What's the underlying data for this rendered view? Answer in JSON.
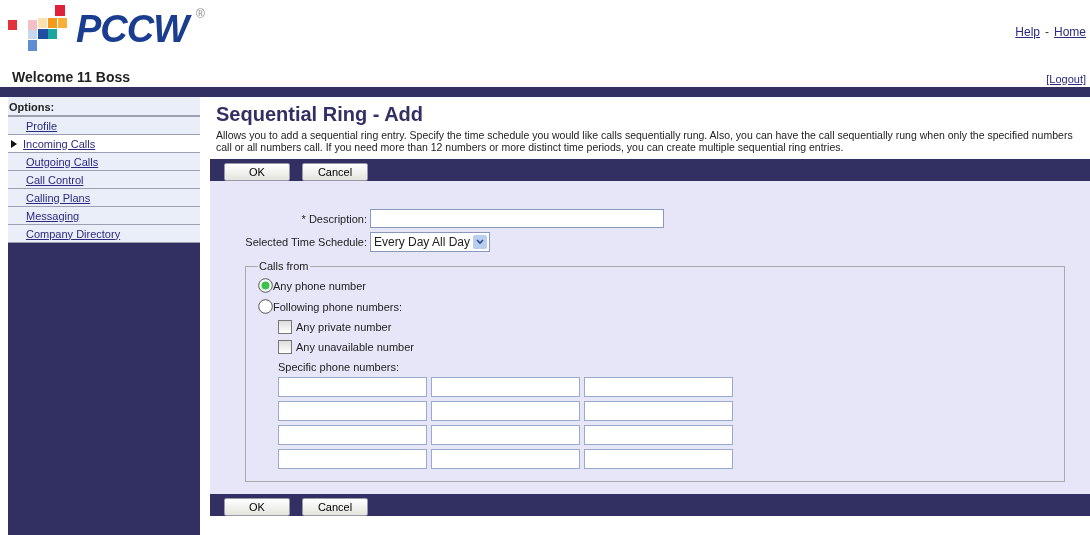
{
  "header": {
    "logo_text": "PCCW",
    "logo_mark": "®",
    "links": [
      {
        "label": "Help"
      },
      {
        "label": "Home"
      }
    ],
    "separator": "-",
    "welcome": "Welcome 11 Boss",
    "logout": "[Logout]"
  },
  "sidebar": {
    "title": "Options:",
    "items": [
      {
        "label": "Profile",
        "selected": false
      },
      {
        "label": "Incoming Calls",
        "selected": true
      },
      {
        "label": "Outgoing Calls",
        "selected": false
      },
      {
        "label": "Call Control",
        "selected": false
      },
      {
        "label": "Calling Plans",
        "selected": false
      },
      {
        "label": "Messaging",
        "selected": false
      },
      {
        "label": "Company Directory",
        "selected": false
      }
    ]
  },
  "page": {
    "title": "Sequential Ring - Add",
    "description": "Allows you to add a sequential ring entry. Specify the time schedule you would like calls sequentially rung. Also, you can have the call sequentially rung when only the specified numbers call or all numbers call. If you need more than 12 numbers or more distinct time periods, you can create multiple sequential ring entries."
  },
  "top_buttons": [
    "OK",
    "Cancel"
  ],
  "form": {
    "description_label": "* Description:",
    "schedule_label": "Selected Time Schedule:",
    "schedule_value": "Every Day All Day",
    "calls_from": {
      "legend": "Calls from",
      "options": [
        {
          "label": "Any phone number",
          "selected": true
        },
        {
          "label": "Following phone numbers:",
          "selected": false
        }
      ],
      "checkboxes": [
        {
          "label": "Any private number",
          "checked": false
        },
        {
          "label": "Any unavailable number",
          "checked": false
        }
      ],
      "specific_label": "Specific phone numbers:",
      "phone_fields": [
        {
          "kind": "input"
        },
        {
          "kind": "input"
        },
        {
          "kind": "input"
        },
        {
          "kind": "input"
        },
        {
          "kind": "input"
        },
        {
          "kind": "input"
        },
        {
          "kind": "input"
        },
        {
          "kind": "input"
        },
        {
          "kind": "input"
        },
        {
          "kind": "input"
        },
        {
          "kind": "input"
        },
        {
          "kind": "input"
        }
      ]
    }
  },
  "bottom_buttons": [
    "OK",
    "Cancel"
  ]
}
